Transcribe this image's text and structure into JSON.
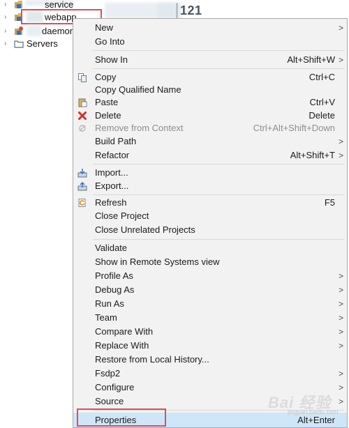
{
  "tree": {
    "items": [
      {
        "label": "service",
        "expand_icon": "chevron-right-icon",
        "icon": "java-project-icon"
      },
      {
        "label": "webapp",
        "expand_icon": "chevron-right-icon",
        "icon": "java-project-icon"
      },
      {
        "label": "daemon",
        "expand_icon": "chevron-right-icon",
        "icon": "java-project-icon"
      },
      {
        "label": "Servers",
        "expand_icon": "chevron-right-icon",
        "icon": "folder-icon"
      }
    ],
    "counter": "121"
  },
  "menu": {
    "new": {
      "label": "New"
    },
    "go_into": {
      "label": "Go Into"
    },
    "show_in": {
      "label": "Show In",
      "accel": "Alt+Shift+W"
    },
    "copy": {
      "label": "Copy",
      "accel": "Ctrl+C",
      "icon": "copy-icon"
    },
    "copy_qualified": {
      "label": "Copy Qualified Name"
    },
    "paste": {
      "label": "Paste",
      "accel": "Ctrl+V",
      "icon": "paste-icon"
    },
    "delete": {
      "label": "Delete",
      "accel": "Delete",
      "icon": "delete-icon"
    },
    "remove_context": {
      "label": "Remove from Context",
      "accel": "Ctrl+Alt+Shift+Down",
      "icon": "remove-context-icon"
    },
    "build_path": {
      "label": "Build Path"
    },
    "refactor": {
      "label": "Refactor",
      "accel": "Alt+Shift+T"
    },
    "import": {
      "label": "Import...",
      "icon": "import-icon"
    },
    "export": {
      "label": "Export...",
      "icon": "export-icon"
    },
    "refresh": {
      "label": "Refresh",
      "accel": "F5",
      "icon": "refresh-icon"
    },
    "close_project": {
      "label": "Close Project"
    },
    "close_unrelated": {
      "label": "Close Unrelated Projects"
    },
    "validate": {
      "label": "Validate"
    },
    "show_remote": {
      "label": "Show in Remote Systems view"
    },
    "profile_as": {
      "label": "Profile As"
    },
    "debug_as": {
      "label": "Debug As"
    },
    "run_as": {
      "label": "Run As"
    },
    "team": {
      "label": "Team"
    },
    "compare_with": {
      "label": "Compare With"
    },
    "replace_with": {
      "label": "Replace With"
    },
    "restore_history": {
      "label": "Restore from Local History..."
    },
    "fsdp2": {
      "label": "Fsdp2"
    },
    "configure": {
      "label": "Configure"
    },
    "source": {
      "label": "Source"
    },
    "properties": {
      "label": "Properties",
      "accel": "Alt+Enter"
    }
  },
  "submenu_arrow": ">",
  "watermark": {
    "text": "Bai 经验",
    "sub": "jingyan.baidu.com"
  },
  "colors": {
    "menu_bg": "#f2f2f2",
    "highlight": "#cfe6f8",
    "annotation": "#e24b5a"
  }
}
